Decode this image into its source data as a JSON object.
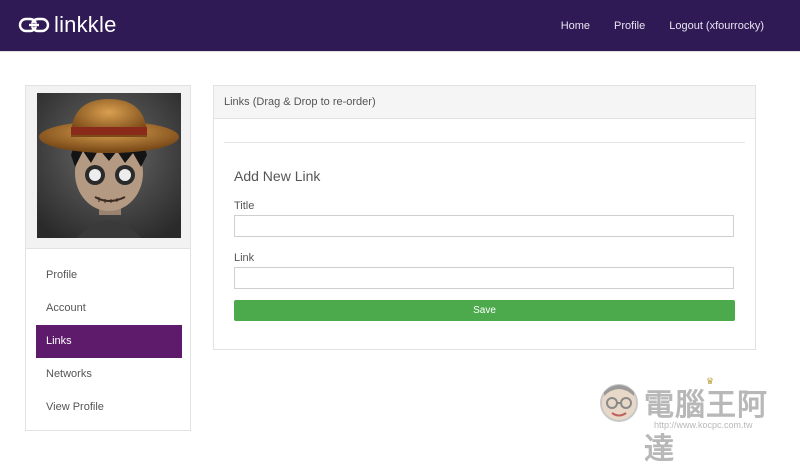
{
  "nav": {
    "brand": "linkkle",
    "links": [
      "Home",
      "Profile",
      "Logout (xfourrocky)"
    ]
  },
  "sidebar": {
    "items": [
      {
        "label": "Profile"
      },
      {
        "label": "Account"
      },
      {
        "label": "Links",
        "active": true
      },
      {
        "label": "Networks"
      },
      {
        "label": "View Profile"
      }
    ]
  },
  "panel": {
    "header": "Links (Drag & Drop to re-order)",
    "form_title": "Add New Link",
    "title_label": "Title",
    "title_value": "",
    "link_label": "Link",
    "link_value": "",
    "save_label": "Save"
  },
  "watermark": {
    "text": "電腦王阿達",
    "url": "http://www.kocpc.com.tw"
  },
  "colors": {
    "navbar": "#301a55",
    "active_menu": "#5e1a6b",
    "save_button": "#4caa4c"
  }
}
